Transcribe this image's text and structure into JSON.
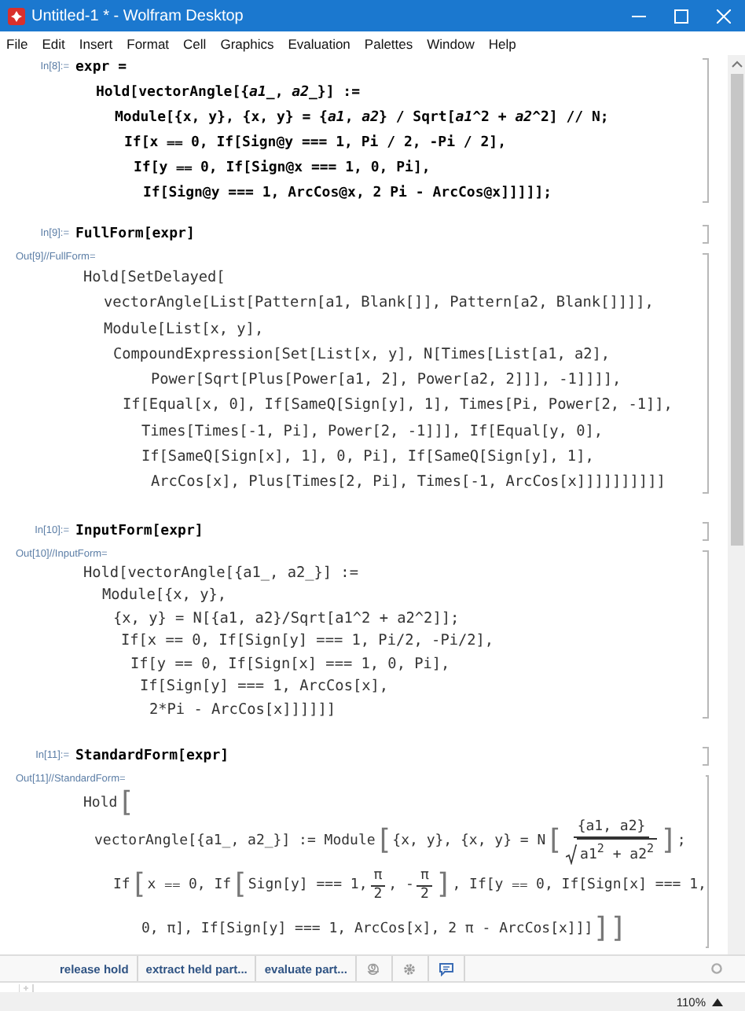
{
  "window": {
    "title": "Untitled-1 * - Wolfram Desktop"
  },
  "menu": [
    "File",
    "Edit",
    "Insert",
    "Format",
    "Cell",
    "Graphics",
    "Evaluation",
    "Palettes",
    "Window",
    "Help"
  ],
  "cells": [
    {
      "kind": "input",
      "label": "In[8]:=",
      "lines": [
        "expr =",
        "Hold[vectorAngle[{*a1_*, *a2_*}] :=",
        "Module[{x, y}, {x, y} = {*a1*, *a2*} / Sqrt[*a1*^2 + *a2*^2] // N;",
        "If[x ⩵ 0, If[Sign@y === 1, Pi / 2, -Pi / 2],",
        "If[y ⩵ 0, If[Sign@x === 1, 0, Pi],",
        "If[Sign@y === 1, ArcCos@x, 2 Pi - ArcCos@x]]]]];"
      ]
    },
    {
      "kind": "input",
      "label": "In[9]:=",
      "lines": [
        "FullForm[expr]"
      ]
    },
    {
      "kind": "output",
      "label": "Out[9]//FullForm=",
      "lines": [
        "Hold[SetDelayed[",
        "vectorAngle[List[Pattern[a1, Blank[]], Pattern[a2, Blank[]]]],",
        "Module[List[x, y],",
        "CompoundExpression[Set[List[x, y], N[Times[List[a1, a2],",
        "Power[Sqrt[Plus[Power[a1, 2], Power[a2, 2]]], -1]]]],",
        "If[Equal[x, 0], If[SameQ[Sign[y], 1], Times[Pi, Power[2, -1]],",
        "Times[Times[-1, Pi], Power[2, -1]]], If[Equal[y, 0],",
        "If[SameQ[Sign[x], 1], 0, Pi], If[SameQ[Sign[y], 1],",
        "ArcCos[x], Plus[Times[2, Pi], Times[-1, ArcCos[x]]]]]]]]]]"
      ]
    },
    {
      "kind": "input",
      "label": "In[10]:=",
      "lines": [
        "InputForm[expr]"
      ]
    },
    {
      "kind": "output",
      "label": "Out[10]//InputForm=",
      "lines": [
        "Hold[vectorAngle[{a1_, a2_}] :=",
        "Module[{x, y},",
        "{x, y} = N[{a1, a2}/Sqrt[a1^2 + a2^2]];",
        "If[x == 0, If[Sign[y] === 1, Pi/2, -Pi/2],",
        "If[y == 0, If[Sign[x] === 1, 0, Pi],",
        "If[Sign[y] === 1, ArcCos[x],",
        "2*Pi - ArcCos[x]]]]]]"
      ]
    },
    {
      "kind": "input",
      "label": "In[11]:=",
      "lines": [
        "StandardForm[expr]"
      ]
    },
    {
      "kind": "formatted",
      "label": "Out[11]//StandardForm=",
      "lines": [
        [
          {
            "kind": "text",
            "text": "Hold"
          },
          {
            "kind": "big",
            "text": "["
          }
        ],
        [
          {
            "kind": "text",
            "text": "vectorAngle[{a1_, a2_}] := Module"
          },
          {
            "kind": "big",
            "text": "["
          },
          {
            "kind": "text",
            "text": "{x, y}, {x, y} = N"
          },
          {
            "kind": "big",
            "text": "["
          },
          {
            "kind": "frac",
            "num": "{a1, a2}",
            "den": "a1$^{2}$ + a2$^{2}$",
            "den_sqrt": true
          },
          {
            "kind": "big",
            "text": "]"
          },
          {
            "kind": "text",
            "text": ";"
          }
        ],
        [
          {
            "kind": "text",
            "text": "If"
          },
          {
            "kind": "big",
            "text": "["
          },
          {
            "kind": "text",
            "text": "x ⩵ 0, If"
          },
          {
            "kind": "big",
            "text": "["
          },
          {
            "kind": "text",
            "text": "Sign[y] === 1,"
          },
          {
            "kind": "frac",
            "num": "π",
            "den": "2",
            "den_sqrt": false
          },
          {
            "kind": "text",
            "text": ", -"
          },
          {
            "kind": "frac",
            "num": "π",
            "den": "2",
            "den_sqrt": false
          },
          {
            "kind": "big",
            "text": "]"
          },
          {
            "kind": "text",
            "text": ", If[y ⩵ 0, If[Sign[x] === 1,"
          }
        ],
        [
          {
            "kind": "text",
            "text": "0, π], If[Sign[y] === 1, ArcCos[x], 2 π - ArcCos[x]]]"
          },
          {
            "kind": "big",
            "text": "]"
          },
          {
            "kind": "big",
            "text": "]"
          }
        ]
      ]
    }
  ],
  "suggestions_bar": {
    "buttons": [
      "release hold",
      "extract held part...",
      "evaluate part..."
    ]
  },
  "status_bar": {
    "zoom": "110%"
  }
}
